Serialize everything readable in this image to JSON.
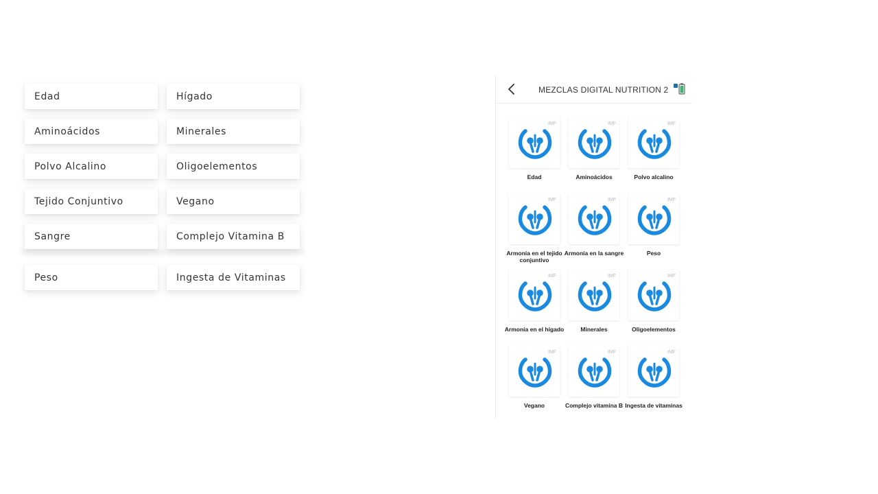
{
  "buttons": [
    {
      "label": "Edad"
    },
    {
      "label": "Hígado"
    },
    {
      "label": "Aminoácidos"
    },
    {
      "label": "Minerales"
    },
    {
      "label": "Polvo Alcalino"
    },
    {
      "label": "Oligoelementos"
    },
    {
      "label": "Tejido Conjuntivo"
    },
    {
      "label": "Vegano"
    },
    {
      "label": "Sangre"
    },
    {
      "label": "Complejo Vitamina B"
    },
    {
      "label": "Peso"
    },
    {
      "label": "Ingesta de Vitaminas"
    }
  ],
  "phone": {
    "title": "MEZCLAS DIGITAL NUTRITION 2",
    "back_icon": "chevron-left-icon",
    "status_icon": "battery-icon",
    "brand": "IMF",
    "logo_color": "#1a8ae0",
    "tiles": [
      {
        "label": "Edad"
      },
      {
        "label": "Aminoácidos"
      },
      {
        "label": "Polvo alcalino"
      },
      {
        "label": "Armonía en el tejido conjuntivo"
      },
      {
        "label": "Armonía en la sangre"
      },
      {
        "label": "Peso"
      },
      {
        "label": "Armonía en el hígado"
      },
      {
        "label": "Minerales"
      },
      {
        "label": "Oligoelementos"
      },
      {
        "label": "Vegano"
      },
      {
        "label": "Complejo vitamina B"
      },
      {
        "label": "Ingesta de vitaminas"
      }
    ]
  }
}
